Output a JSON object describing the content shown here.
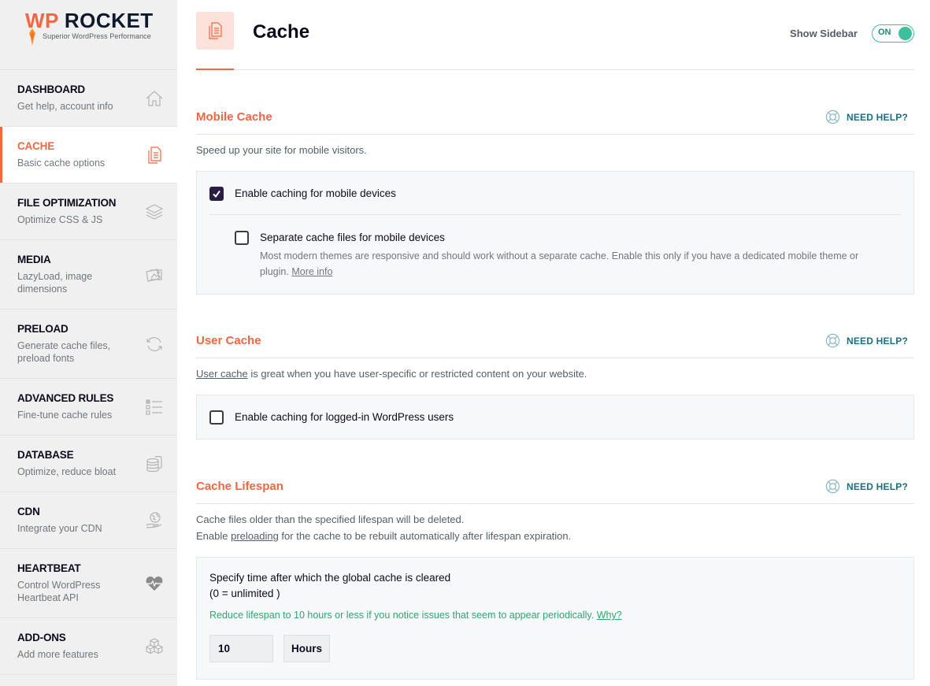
{
  "logo": {
    "wp": "WP",
    "rocket": "ROCKET",
    "tagline": "Superior WordPress Performance"
  },
  "sidebar": {
    "items": [
      {
        "title": "DASHBOARD",
        "desc": "Get help, account info",
        "icon": "home-icon",
        "active": false
      },
      {
        "title": "CACHE",
        "desc": "Basic cache options",
        "icon": "document-icon",
        "active": true
      },
      {
        "title": "FILE OPTIMIZATION",
        "desc": "Optimize CSS & JS",
        "icon": "layers-icon",
        "active": false
      },
      {
        "title": "MEDIA",
        "desc": "LazyLoad, image dimensions",
        "icon": "images-icon",
        "active": false
      },
      {
        "title": "PRELOAD",
        "desc": "Generate cache files, preload fonts",
        "icon": "refresh-icon",
        "active": false
      },
      {
        "title": "ADVANCED RULES",
        "desc": "Fine-tune cache rules",
        "icon": "checklist-icon",
        "active": false
      },
      {
        "title": "DATABASE",
        "desc": "Optimize, reduce bloat",
        "icon": "database-icon",
        "active": false
      },
      {
        "title": "CDN",
        "desc": "Integrate your CDN",
        "icon": "globe-hand-icon",
        "active": false
      },
      {
        "title": "HEARTBEAT",
        "desc": "Control WordPress Heartbeat API",
        "icon": "heartbeat-icon",
        "active": false
      },
      {
        "title": "ADD-ONS",
        "desc": "Add more features",
        "icon": "cubes-icon",
        "active": false
      }
    ]
  },
  "header": {
    "title": "Cache",
    "show_sidebar_label": "Show Sidebar",
    "toggle_state": "ON"
  },
  "colors": {
    "accent": "#f56640",
    "toggle_green": "#40bf9e",
    "help_blue": "#1b6f85",
    "hint_green": "#2ea66e",
    "checkbox_dark": "#2b1c45"
  },
  "sections": {
    "mobile": {
      "title": "Mobile Cache",
      "help": "NEED HELP?",
      "desc": "Speed up your site for mobile visitors.",
      "opt1_label": "Enable caching for mobile devices",
      "opt1_checked": true,
      "opt2_label": "Separate cache files for mobile devices",
      "opt2_checked": false,
      "opt2_desc": "Most modern themes are responsive and should work without a separate cache. Enable this only if you have a dedicated mobile theme or plugin.",
      "opt2_link": "More info"
    },
    "user": {
      "title": "User Cache",
      "help": "NEED HELP?",
      "desc_link": "User cache",
      "desc_rest": " is great when you have user-specific or restricted content on your website.",
      "opt1_label": "Enable caching for logged-in WordPress users",
      "opt1_checked": false
    },
    "lifespan": {
      "title": "Cache Lifespan",
      "help": "NEED HELP?",
      "desc_line1": "Cache files older than the specified lifespan will be deleted.",
      "desc_line2_pre": "Enable ",
      "desc_line2_link": "preloading",
      "desc_line2_post": " for the cache to be rebuilt automatically after lifespan expiration.",
      "field_label": "Specify time after which the global cache is cleared",
      "field_label2": "(0 = unlimited )",
      "hint": "Reduce lifespan to 10 hours or less if you notice issues that seem to appear periodically.",
      "hint_link": "Why?",
      "value": "10",
      "unit": "Hours"
    }
  }
}
